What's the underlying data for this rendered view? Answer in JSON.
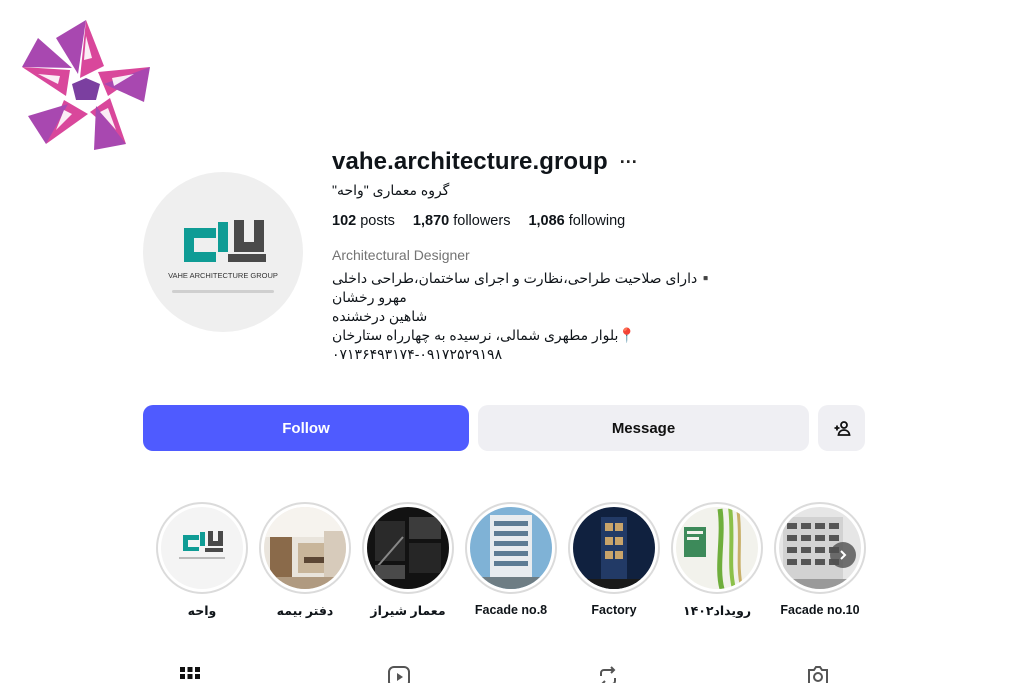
{
  "profile": {
    "username": "vahe.architecture.group",
    "more_icon": "ellipsis-icon",
    "full_name": "گروه معماری \"واحه\"",
    "stats": {
      "posts_count": "102",
      "posts_label": "posts",
      "followers_count": "1,870",
      "followers_label": "followers",
      "following_count": "1,086",
      "following_label": "following"
    },
    "category": "Architectural Designer",
    "bio": [
      "▪️دارای صلاحیت طراحی،نظارت و اجرای ساختمان،طراحی داخلی",
      "مهرو رخشان",
      "شاهین درخشنده",
      "📍بلوار مطهری شمالی، نرسیده به چهارراه ستارخان",
      "۰۷۱۳۶۴۹۳۱۷۴-۰۹۱۷۲۵۲۹۱۹۸"
    ],
    "avatar_text": "VAHE ARCHITECTURE GROUP"
  },
  "actions": {
    "follow_label": "Follow",
    "message_label": "Message",
    "add_icon": "add-person-icon"
  },
  "highlights": [
    {
      "label": "واحه"
    },
    {
      "label": "دفتر بیمه"
    },
    {
      "label": "معمار شیراز"
    },
    {
      "label": "Facade no.8"
    },
    {
      "label": "Factory"
    },
    {
      "label": "رویداد۱۴۰۲"
    },
    {
      "label": "Facade no.10"
    }
  ],
  "tabs": [
    {
      "icon": "grid-icon"
    },
    {
      "icon": "reels-icon"
    },
    {
      "icon": "repost-icon"
    },
    {
      "icon": "tagged-icon"
    }
  ],
  "colors": {
    "follow_bg": "#4f5bff",
    "secondary_bg": "#efeff3",
    "logo_teal": "#0f9c95",
    "watermark_pink": "#d9479b",
    "watermark_purple": "#7b3fa0"
  }
}
